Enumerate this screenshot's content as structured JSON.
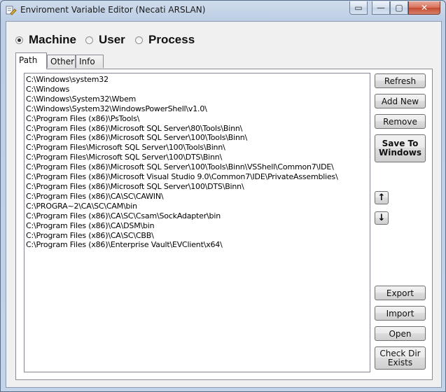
{
  "window": {
    "title": "Enviroment Variable Editor (Necati ARSLAN)"
  },
  "caption_buttons": {
    "extra": "▭",
    "minimize": "—",
    "maximize": "▢",
    "close": "✕"
  },
  "scope": {
    "options": [
      "Machine",
      "User",
      "Process"
    ],
    "selected": "Machine"
  },
  "tabs": [
    "Path",
    "Other",
    "Info"
  ],
  "active_tab": "Path",
  "path_list": [
    "C:\\Windows\\system32",
    "C:\\Windows",
    "C:\\Windows\\System32\\Wbem",
    "C:\\Windows\\System32\\WindowsPowerShell\\v1.0\\",
    "C:\\Program Files (x86)\\PsTools\\",
    "C:\\Program Files (x86)\\Microsoft SQL Server\\80\\Tools\\Binn\\",
    "C:\\Program Files (x86)\\Microsoft SQL Server\\100\\Tools\\Binn\\",
    "C:\\Program Files\\Microsoft SQL Server\\100\\Tools\\Binn\\",
    "C:\\Program Files\\Microsoft SQL Server\\100\\DTS\\Binn\\",
    "C:\\Program Files (x86)\\Microsoft SQL Server\\100\\Tools\\Binn\\VSShell\\Common7\\IDE\\",
    "C:\\Program Files (x86)\\Microsoft Visual Studio 9.0\\Common7\\IDE\\PrivateAssemblies\\",
    "C:\\Program Files (x86)\\Microsoft SQL Server\\100\\DTS\\Binn\\",
    "C:\\Program Files (x86)\\CA\\SC\\CAWIN\\",
    "C:\\PROGRA~2\\CA\\SC\\CAM\\bin",
    "C:\\Program Files (x86)\\CA\\SC\\Csam\\SockAdapter\\bin",
    "C:\\Program Files (x86)\\CA\\DSM\\bin",
    "C:\\Program Files (x86)\\CA\\SC\\CBB\\",
    "C:\\Program Files (x86)\\Enterprise Vault\\EVClient\\x64\\"
  ],
  "buttons": {
    "refresh": "Refresh",
    "add_new": "Add New",
    "remove": "Remove",
    "save_line1": "Save To",
    "save_line2": "Windows",
    "move_up": "↑",
    "move_down": "↓",
    "export": "Export",
    "import": "Import",
    "open": "Open",
    "check_line1": "Check Dir",
    "check_line2": "Exists"
  }
}
